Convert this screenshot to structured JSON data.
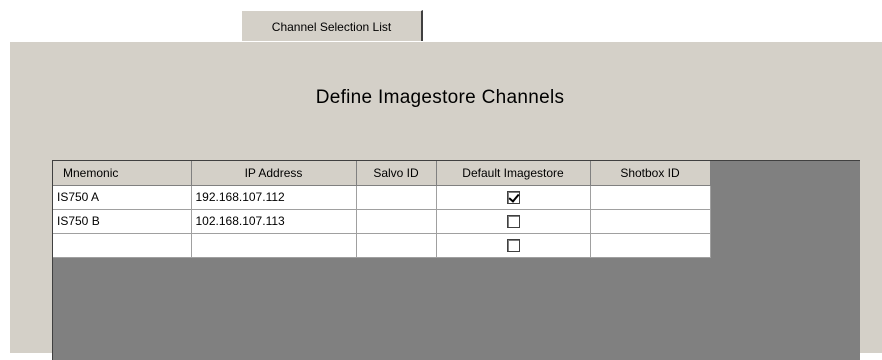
{
  "tab": {
    "label": "Channel Selection List"
  },
  "heading": "Define Imagestore Channels",
  "table": {
    "columns": [
      "Mnemonic",
      "IP Address",
      "Salvo ID",
      "Default Imagestore",
      "Shotbox ID"
    ],
    "rows": [
      {
        "mnemonic": "IS750 A",
        "ip": "192.168.107.112",
        "salvo_id": "",
        "default_imagestore": true,
        "shotbox_id": ""
      },
      {
        "mnemonic": "IS750 B",
        "ip": "102.168.107.113",
        "salvo_id": "",
        "default_imagestore": false,
        "shotbox_id": ""
      },
      {
        "mnemonic": "",
        "ip": "",
        "salvo_id": "",
        "default_imagestore": false,
        "shotbox_id": ""
      }
    ]
  }
}
